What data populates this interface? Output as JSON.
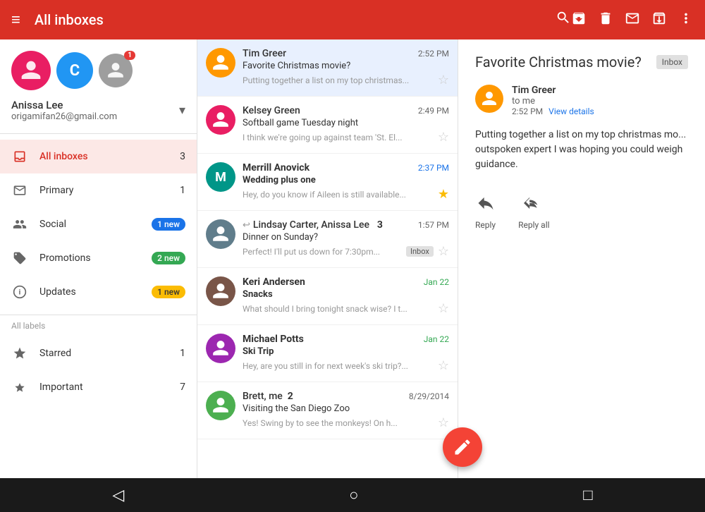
{
  "topbar": {
    "title": "All inboxes",
    "menu_icon": "≡",
    "search_icon": "🔍",
    "action1": "📥",
    "action2": "🗑",
    "action3": "✉",
    "action4": "📤",
    "more_icon": "⋮"
  },
  "sidebar": {
    "account": {
      "name": "Anissa Lee",
      "email": "origamifan26@gmail.com"
    },
    "nav_items": [
      {
        "label": "All inboxes",
        "count": "3",
        "active": true,
        "icon": "☰"
      },
      {
        "label": "Primary",
        "count": "1",
        "active": false,
        "icon": "☐"
      },
      {
        "label": "Social",
        "badge": "1 new",
        "badge_color": "blue",
        "active": false,
        "icon": "👥"
      },
      {
        "label": "Promotions",
        "badge": "2 new",
        "badge_color": "green",
        "active": false,
        "icon": "🏷"
      },
      {
        "label": "Updates",
        "badge": "1 new",
        "badge_color": "yellow",
        "active": false,
        "icon": "ℹ"
      }
    ],
    "labels_section": "All labels",
    "label_items": [
      {
        "label": "Starred",
        "count": "1",
        "icon": "★"
      },
      {
        "label": "Important",
        "count": "7",
        "icon": "▶"
      }
    ]
  },
  "emails": [
    {
      "sender": "Tim Greer",
      "subject": "Favorite Christmas movie?",
      "preview": "Putting together a list on my top christmas...",
      "time": "2:52 PM",
      "time_color": "normal",
      "selected": true,
      "unread": false,
      "starred": false,
      "avatar_letter": "",
      "avatar_color": "orange",
      "has_inbox_badge": false,
      "has_reply": false
    },
    {
      "sender": "Kelsey Green",
      "subject": "Softball game Tuesday night",
      "preview": "I think we're going up against team 'St. El...",
      "time": "2:49 PM",
      "time_color": "normal",
      "selected": false,
      "unread": false,
      "starred": false,
      "avatar_letter": "",
      "avatar_color": "pink",
      "has_inbox_badge": false,
      "has_reply": false
    },
    {
      "sender": "Merrill Anovick",
      "subject": "Wedding plus one",
      "preview": "Hey, do you know if Aileen is still available...",
      "time": "2:37 PM",
      "time_color": "blue",
      "selected": false,
      "unread": true,
      "starred": true,
      "avatar_letter": "M",
      "avatar_color": "teal",
      "has_inbox_badge": false,
      "has_reply": false
    },
    {
      "sender": "Lindsay Carter, Anissa Lee  3",
      "subject": "Dinner on Sunday?",
      "preview": "Perfect! I'll put us down for 7:30pm...",
      "time": "1:57 PM",
      "time_color": "normal",
      "selected": false,
      "unread": false,
      "starred": false,
      "avatar_letter": "",
      "avatar_color": "grey",
      "has_inbox_badge": true,
      "has_reply": true
    },
    {
      "sender": "Keri Andersen",
      "subject": "Snacks",
      "preview": "What should I bring tonight snack wise? I t...",
      "time": "Jan 22",
      "time_color": "green",
      "selected": false,
      "unread": true,
      "starred": false,
      "avatar_letter": "",
      "avatar_color": "brown",
      "has_inbox_badge": false,
      "has_reply": false
    },
    {
      "sender": "Michael Potts",
      "subject": "Ski Trip",
      "preview": "Hey, are you still in for next week's ski trip?...",
      "time": "Jan 22",
      "time_color": "green",
      "selected": false,
      "unread": true,
      "starred": false,
      "avatar_letter": "",
      "avatar_color": "purple",
      "has_inbox_badge": false,
      "has_reply": false
    },
    {
      "sender": "Brett, me  2",
      "subject": "Visiting the San Diego Zoo",
      "preview": "Yes! Swing by to see the monkeys! On h...",
      "time": "8/29/2014",
      "time_color": "normal",
      "selected": false,
      "unread": false,
      "starred": false,
      "avatar_letter": "",
      "avatar_color": "green",
      "has_inbox_badge": false,
      "has_reply": false
    }
  ],
  "detail": {
    "subject": "Favorite Christmas movie?",
    "inbox_badge": "Inbox",
    "sender_name": "Tim Greer",
    "to": "to me",
    "time": "2:52 PM",
    "view_details": "View details",
    "body": "Putting together a list on my top christmas mo... outspoken expert I was hoping you could weigh guidance.",
    "reply_label": "Reply",
    "reply_all_label": "Reply all"
  },
  "fab": {
    "icon": "✎"
  },
  "bottom_nav": {
    "back_icon": "◁",
    "home_icon": "○",
    "square_icon": "□"
  }
}
